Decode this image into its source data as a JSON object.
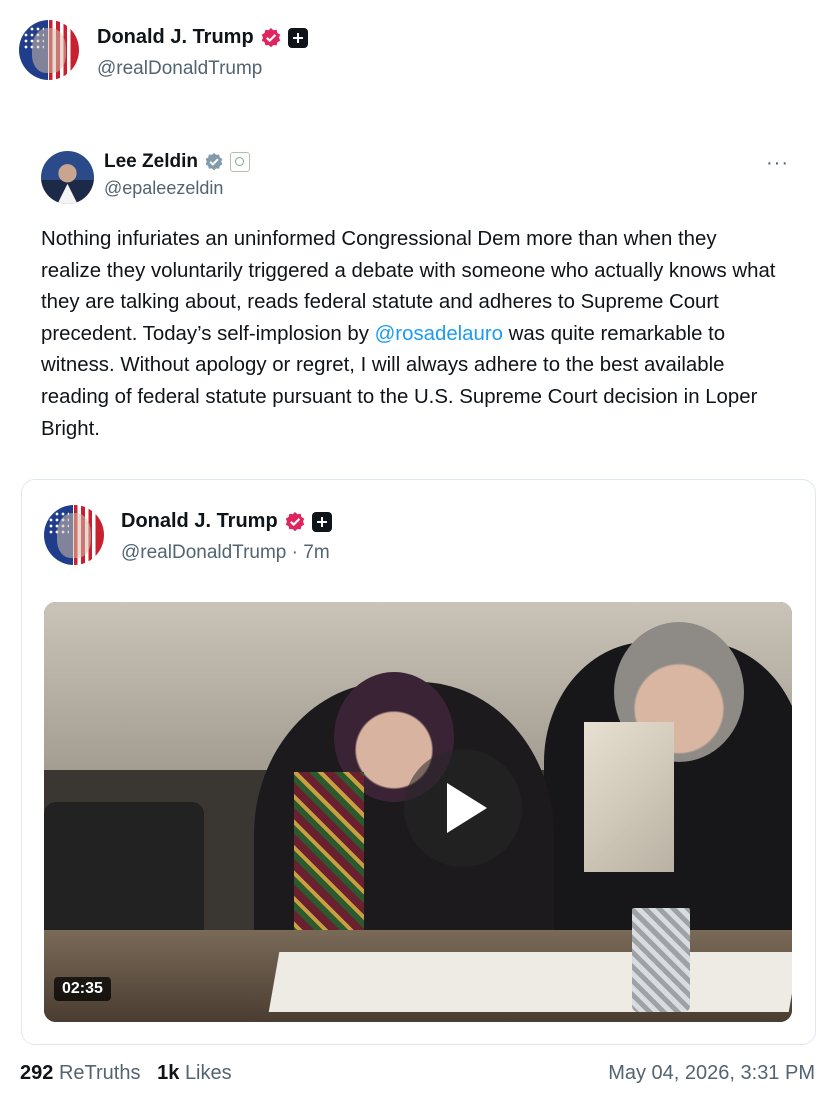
{
  "post": {
    "author_name": "Donald J. Trump",
    "author_handle": "@realDonaldTrump",
    "stats": {
      "retruths_count": "292",
      "retruths_label": "ReTruths",
      "likes_count": "1k",
      "likes_label": "Likes"
    },
    "timestamp": "May 04, 2026, 3:31 PM"
  },
  "embedded_tweet": {
    "author_name": "Lee Zeldin",
    "author_handle": "@epaleezeldin",
    "more_label": "···",
    "text_before": "Nothing infuriates an uninformed Congressional Dem more than when they realize they voluntarily triggered a debate with someone who actually knows what they are talking about, reads federal statute and adheres to Supreme Court precedent. Today’s self-implosion by ",
    "mention": "@rosadelauro",
    "text_after": " was quite remarkable to witness. Without apology or regret, I will always adhere to the best available reading of federal statute pursuant to the U.S. Supreme Court decision in Loper Bright."
  },
  "quoted_post": {
    "author_name": "Donald J. Trump",
    "author_handle": "@realDonaldTrump",
    "time_ago": "· 7m",
    "video": {
      "duration": "02:35"
    }
  },
  "colors": {
    "verified": "#e0245e",
    "link": "#1d9bf0",
    "muted": "#536471"
  },
  "icons": [
    "verified-badge-icon",
    "plus-badge-icon",
    "gray-verified-icon",
    "agency-seal-icon",
    "more-icon",
    "play-icon"
  ]
}
